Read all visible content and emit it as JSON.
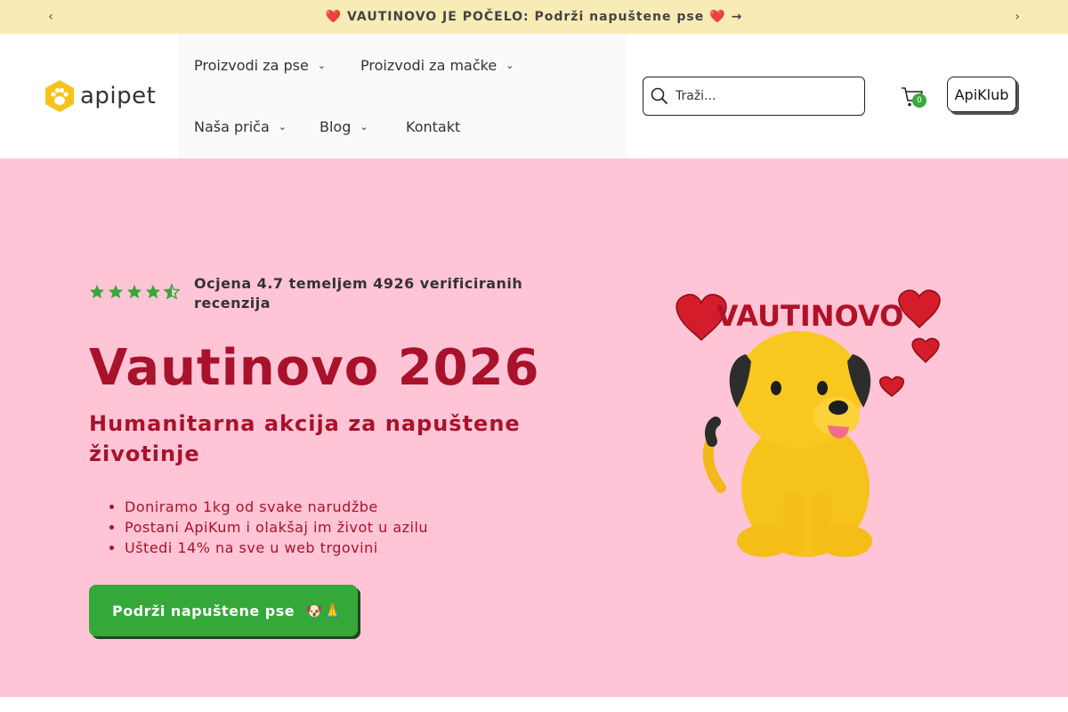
{
  "announcement": {
    "heart_left": "❤️",
    "text": "VAUTINOVO JE POČELO: Podrži napuštene pse",
    "heart_right": "❤️",
    "arrow": "→",
    "prev_icon": "‹",
    "next_icon": "›"
  },
  "header": {
    "logo_text": "apipet",
    "nav": [
      {
        "label": "Proizvodi za pse",
        "has_dropdown": true
      },
      {
        "label": "Proizvodi za mačke",
        "has_dropdown": true
      },
      {
        "label": "Naša priča",
        "has_dropdown": true
      },
      {
        "label": "Blog",
        "has_dropdown": true
      },
      {
        "label": "Kontakt",
        "has_dropdown": false
      }
    ],
    "chevron": "⌄",
    "search_placeholder": "Traži...",
    "cart_count": "0",
    "club_label": "ApiKlub"
  },
  "hero": {
    "rating_value": 4.7,
    "rating_text": "Ocjena 4.7 temeljem 4926 verificiranih recenzija",
    "title": "Vautinovo 2026",
    "subtitle": "Humanitarna akcija za napuštene životinje",
    "bullets": [
      "Doniramo 1kg od svake narudžbe",
      "Postani ApiKum i olakšaj im život u azilu",
      "Uštedi 14% na sve u web trgovini"
    ],
    "cta_label": "Podrži napuštene pse",
    "cta_emoji": "🐶🙏",
    "illustration_title": "VAUTINOVO"
  },
  "colors": {
    "announcement_bg": "#f8ebb6",
    "hero_bg": "#ffc5d6",
    "accent_red": "#a8122a",
    "green": "#35a83a",
    "logo_yellow": "#f6c21c"
  }
}
